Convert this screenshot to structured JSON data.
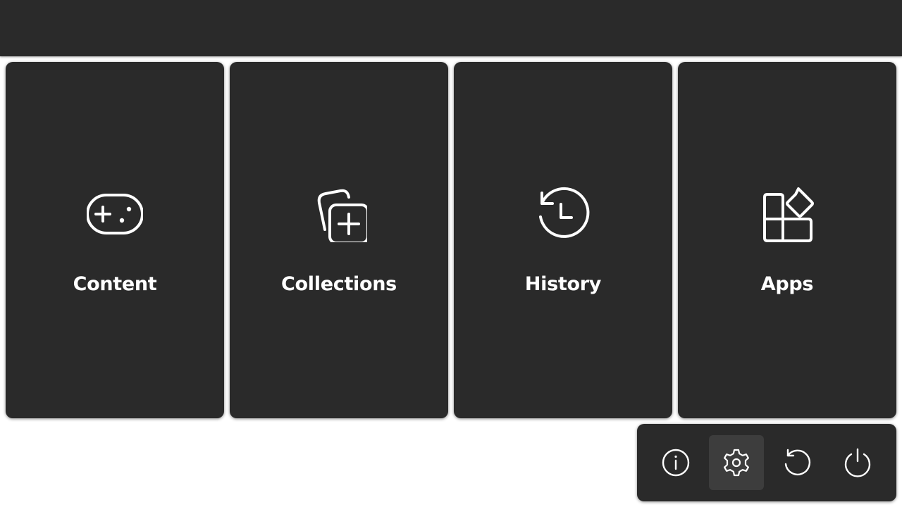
{
  "header": {},
  "tiles": [
    {
      "label": "Content",
      "icon": "gamepad-icon"
    },
    {
      "label": "Collections",
      "icon": "collection-add-icon"
    },
    {
      "label": "History",
      "icon": "history-icon"
    },
    {
      "label": "Apps",
      "icon": "apps-icon"
    }
  ],
  "power_menu": {
    "buttons": [
      {
        "icon": "info-icon"
      },
      {
        "icon": "gear-icon",
        "selected": true
      },
      {
        "icon": "restart-icon"
      },
      {
        "icon": "power-icon"
      }
    ]
  },
  "colors": {
    "panel": "#2a2a2a",
    "selected": "#3d3d3d",
    "foreground": "#ffffff",
    "background": "#ffffff"
  }
}
